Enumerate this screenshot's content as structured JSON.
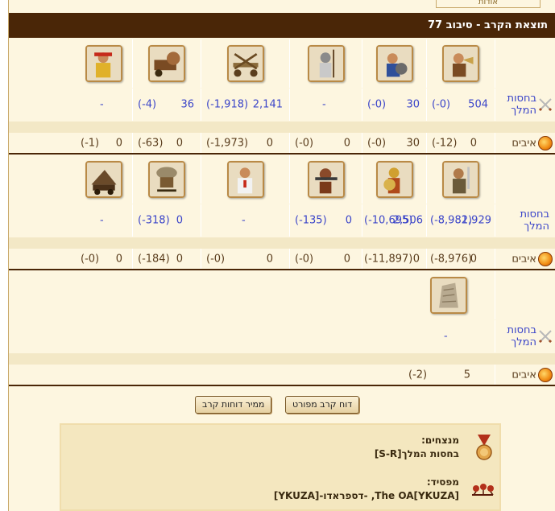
{
  "top_tab": "אודות",
  "header": {
    "title": "תוצאת הקרב - סיבוב 77"
  },
  "labels": {
    "royal_guard": "בחסות המלך",
    "enemies": "איבים"
  },
  "section1": {
    "units": [
      "trumpeter-unit",
      "hoplite-unit",
      "spearman-unit",
      "ballista-unit",
      "catapult-unit",
      "slinger-unit"
    ],
    "guard": [
      {
        "count": "504",
        "loss": "(0-)"
      },
      {
        "count": "30",
        "loss": "(0-)"
      },
      {
        "count": "",
        "loss": "-"
      },
      {
        "count": "2,141",
        "loss": "(1,918-)"
      },
      {
        "count": "36",
        "loss": "(4-)"
      },
      {
        "count": "",
        "loss": "-"
      }
    ],
    "enemies": [
      {
        "count": "0",
        "loss": "(12-)"
      },
      {
        "count": "30",
        "loss": "(0-)"
      },
      {
        "count": "0",
        "loss": "(0-)"
      },
      {
        "count": "0",
        "loss": "(1,973-)"
      },
      {
        "count": "0",
        "loss": "(63-)"
      },
      {
        "count": "0",
        "loss": "(1-)"
      }
    ]
  },
  "section2": {
    "units": [
      "swordsman-unit",
      "phalanx-unit",
      "gunner-unit",
      "doctor-unit",
      "gyrocopter-unit",
      "ram-unit"
    ],
    "guard": [
      {
        "count": "1,929",
        "loss": "(8,982-)"
      },
      {
        "count": "2,506",
        "loss": "(10,695-)"
      },
      {
        "count": "0",
        "loss": "(135-)"
      },
      {
        "count": "",
        "loss": "-"
      },
      {
        "count": "0",
        "loss": "(318-)"
      },
      {
        "count": "",
        "loss": "-"
      }
    ],
    "enemies": [
      {
        "count": "0",
        "loss": "(8,976-)"
      },
      {
        "count": "0",
        "loss": "(11,897-)"
      },
      {
        "count": "0",
        "loss": "(0-)"
      },
      {
        "count": "0",
        "loss": "(0-)"
      },
      {
        "count": "0",
        "loss": "(184-)"
      },
      {
        "count": "0",
        "loss": "(0-)"
      }
    ]
  },
  "section3": {
    "units": [
      "wall-unit"
    ],
    "guard": [
      {
        "count": "",
        "loss": "-"
      }
    ],
    "enemies": [
      {
        "count": "5",
        "loss": "(2-)"
      }
    ]
  },
  "buttons": {
    "detailed": "דוח קרב מפורט",
    "converter": "ממיר דוחות קרב"
  },
  "summary": {
    "winners_label": "מנצחים:",
    "winners_value": "בחסות המלך[S-R]",
    "losers_label": "מפסיד:",
    "losers_value": "The OA[YKUZA], -דספראדו-[YKUZA]"
  },
  "colors": {
    "header": "#4a2607",
    "link": "#3b45c9",
    "panel": "#fdf6e0",
    "band": "#f3e8c6"
  }
}
